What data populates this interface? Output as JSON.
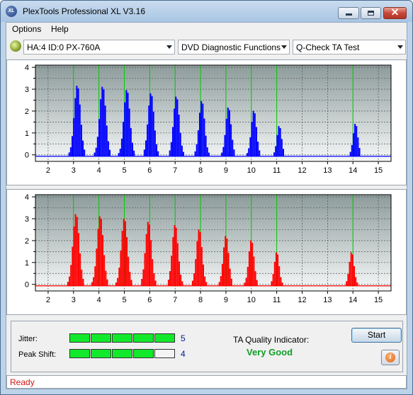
{
  "window": {
    "title": "PlexTools Professional XL V3.16",
    "app_icon_text": "XL"
  },
  "menu": {
    "items": [
      "Options",
      "Help"
    ]
  },
  "toolbar": {
    "drive": "HA:4 ID:0  PX-760A",
    "function": "DVD Diagnostic Functions",
    "test": "Q-Check TA Test"
  },
  "colors": {
    "top_series": "#0000ff",
    "bottom_series": "#ff0000",
    "marker_lines": "#00cc00",
    "quality_text": "#129e28",
    "status_text": "#d41414"
  },
  "chart_data": [
    {
      "type": "bar",
      "title": "",
      "xlabel": "",
      "ylabel": "",
      "xlim": [
        1.5,
        15.5
      ],
      "ylim": [
        -0.3,
        4.1
      ],
      "x_ticks": [
        "2",
        "3",
        "4",
        "5",
        "6",
        "7",
        "8",
        "9",
        "10",
        "11",
        "12",
        "13",
        "14",
        "15"
      ],
      "y_ticks": [
        "0",
        "0.5",
        "1",
        "1.5",
        "2",
        "2.5",
        "3",
        "3.5",
        "4"
      ],
      "grid": true,
      "marker_lines_x": [
        3,
        4,
        5,
        6,
        7,
        8,
        9,
        10,
        11,
        14
      ],
      "peaks": [
        {
          "center": 3.15,
          "peak": 3.2
        },
        {
          "center": 4.15,
          "peak": 3.15
        },
        {
          "center": 5.1,
          "peak": 3.0
        },
        {
          "center": 6.05,
          "peak": 2.85
        },
        {
          "center": 7.05,
          "peak": 2.7
        },
        {
          "center": 8.05,
          "peak": 2.5
        },
        {
          "center": 9.1,
          "peak": 2.2
        },
        {
          "center": 10.1,
          "peak": 2.05
        },
        {
          "center": 11.1,
          "peak": 1.35
        },
        {
          "center": 14.1,
          "peak": 1.45
        }
      ]
    },
    {
      "type": "bar",
      "title": "",
      "xlabel": "",
      "ylabel": "",
      "xlim": [
        1.5,
        15.5
      ],
      "ylim": [
        -0.3,
        4.1
      ],
      "x_ticks": [
        "2",
        "3",
        "4",
        "5",
        "6",
        "7",
        "8",
        "9",
        "10",
        "11",
        "12",
        "13",
        "14",
        "15"
      ],
      "y_ticks": [
        "0",
        "0.5",
        "1",
        "1.5",
        "2",
        "2.5",
        "3",
        "3.5",
        "4"
      ],
      "grid": true,
      "marker_lines_x": [
        3,
        4,
        5,
        6,
        7,
        8,
        9,
        10,
        11,
        14
      ],
      "peaks": [
        {
          "center": 3.1,
          "peak": 3.25
        },
        {
          "center": 4.05,
          "peak": 3.15
        },
        {
          "center": 5.0,
          "peak": 3.05
        },
        {
          "center": 5.95,
          "peak": 2.9
        },
        {
          "center": 7.0,
          "peak": 2.75
        },
        {
          "center": 7.95,
          "peak": 2.55
        },
        {
          "center": 9.0,
          "peak": 2.25
        },
        {
          "center": 10.0,
          "peak": 2.05
        },
        {
          "center": 11.0,
          "peak": 1.5
        },
        {
          "center": 13.95,
          "peak": 1.5
        }
      ]
    }
  ],
  "results": {
    "jitter_label": "Jitter:",
    "jitter_value": "5",
    "jitter_level": 5,
    "peak_shift_label": "Peak Shift:",
    "peak_shift_value": "4",
    "peak_shift_level": 4,
    "meter_segments": 5,
    "ta_label": "TA Quality Indicator:",
    "ta_value": "Very Good"
  },
  "buttons": {
    "start": "Start",
    "info_icon_text": "i"
  },
  "status": {
    "text": "Ready"
  }
}
